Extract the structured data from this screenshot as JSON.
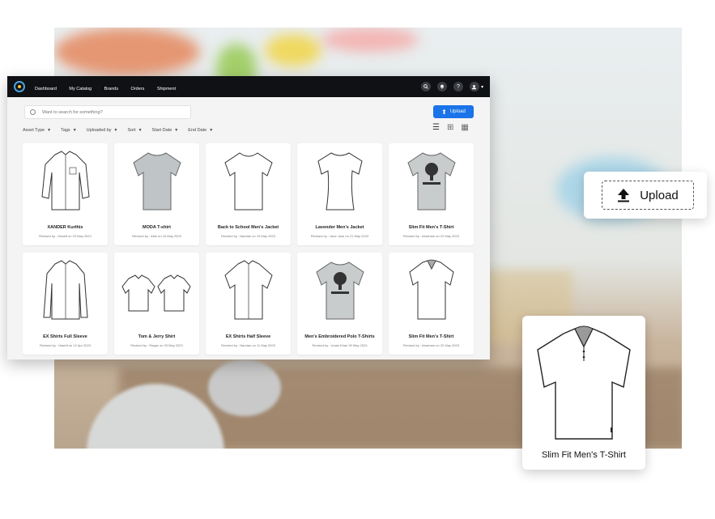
{
  "nav": {
    "items": [
      "Dashboard",
      "My Catalog",
      "Brands",
      "Orders",
      "Shipment"
    ],
    "icons": [
      "search-icon",
      "bell-icon",
      "help-icon",
      "user-icon"
    ],
    "help_glyph": "?"
  },
  "search": {
    "placeholder": "Want to search for something?"
  },
  "upload_button": {
    "label": "Upload"
  },
  "filters": [
    "Asset Type",
    "Tags",
    "Uploaded by",
    "Sort",
    "Start Date",
    "End Date"
  ],
  "view_modes": [
    "list-view-icon",
    "grid-large-icon",
    "grid-small-icon"
  ],
  "products": [
    {
      "title": "XANDER Kurthis",
      "subtitle": "Revised by : Haahif on 23 May 2023",
      "icon": "shirt-long-sleeve-icon"
    },
    {
      "title": "MODA T-shirt",
      "subtitle": "Revised by : Abin on 16 May 2023",
      "icon": "tshirt-grey-icon"
    },
    {
      "title": "Back to School Men's Jacket",
      "subtitle": "Revised by : Nandan on 19 May 2023",
      "icon": "tshirt-outline-icon"
    },
    {
      "title": "Lavender Men's Jacket",
      "subtitle": "Revised by : Jane Jose on 21 May 2023",
      "icon": "tshirt-womens-icon"
    },
    {
      "title": "Slim Fit Men's T-Shirt",
      "subtitle": "Revised by : Abraham on 22 May 2023",
      "icon": "tshirt-print-icon"
    },
    {
      "title": "EX Shirts Full Sleeve",
      "subtitle": "Revised by : Haahif on 12 Apr 2023",
      "icon": "shirt-long-sleeve-icon"
    },
    {
      "title": "Tom & Jerry Shirt",
      "subtitle": "Revised by : Ragav on 03 May 2023",
      "icon": "shirt-pair-icon"
    },
    {
      "title": "EX Shirts Half Sleeve",
      "subtitle": "Revised by : Nandan on 11 May 2023",
      "icon": "shirt-short-sleeve-icon"
    },
    {
      "title": "Men's Embroidered Polo T-Shirts",
      "subtitle": "Revised by : Unais Khan 30 May 2023",
      "icon": "tshirt-print-icon"
    },
    {
      "title": "Slim Fit Men's T-Shirt",
      "subtitle": "Revised by : Abraham on 22 May 2023",
      "icon": "polo-shirt-icon"
    }
  ],
  "float_upload": {
    "label": "Upload"
  },
  "float_product": {
    "label": "Slim Fit Men's T-Shirt"
  },
  "colors": {
    "topbar": "#0f1114",
    "accent": "#1a73e8",
    "panel": "#f4f4f4"
  }
}
